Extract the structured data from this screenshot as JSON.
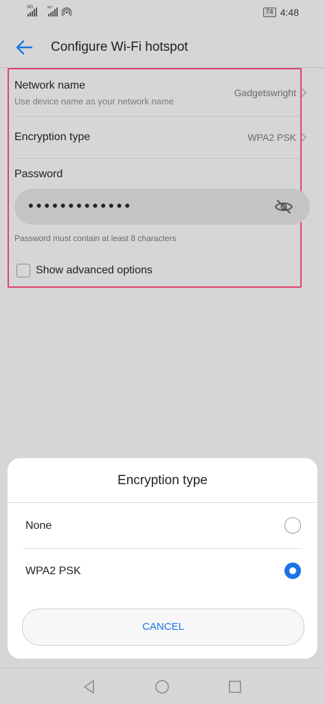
{
  "status": {
    "sim1_label": "3G",
    "sim2_label": "H⁺",
    "battery": "74",
    "time": "4:48"
  },
  "header": {
    "title": "Configure Wi-Fi hotspot"
  },
  "settings": {
    "network_name_label": "Network name",
    "network_name_sub": "Use device name as your network name",
    "network_name_value": "Gadgetswright",
    "encryption_label": "Encryption type",
    "encryption_value": "WPA2 PSK",
    "password_label": "Password",
    "password_masked": "•••••••••••••",
    "password_hint": "Password must contain at least 8 characters",
    "advanced_label": "Show advanced options",
    "advanced_checked": false
  },
  "dialog": {
    "title": "Encryption type",
    "options": [
      {
        "label": "None",
        "selected": false
      },
      {
        "label": "WPA2 PSK",
        "selected": true
      }
    ],
    "cancel_label": "CANCEL"
  },
  "colors": {
    "accent": "#1a73e8",
    "highlight_border": "#e0416a"
  },
  "icons": [
    "back-arrow-icon",
    "chevron-right-icon",
    "eye-off-icon",
    "nav-back-icon",
    "nav-home-icon",
    "nav-recents-icon"
  ]
}
